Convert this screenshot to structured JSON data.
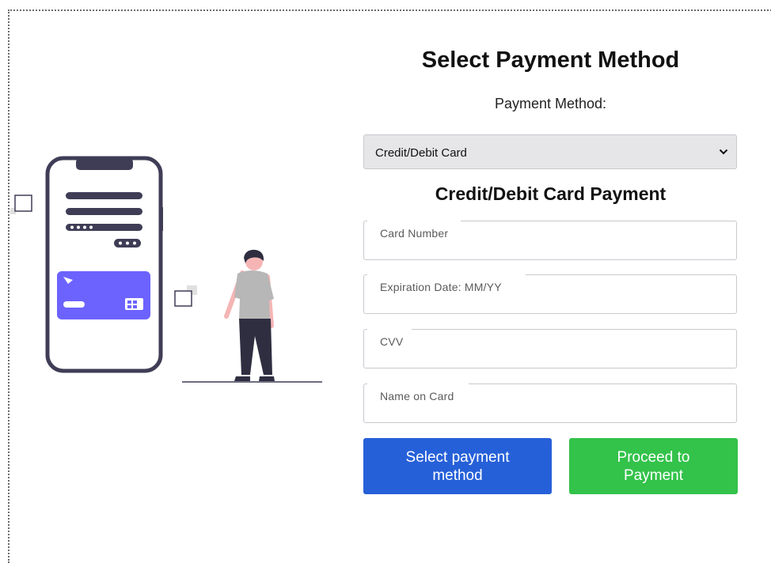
{
  "page": {
    "heading": "Select Payment Method",
    "method_label": "Payment Method:"
  },
  "payment_select": {
    "selected": "Credit/Debit Card",
    "icon": "chevron-down-icon"
  },
  "card_section": {
    "heading": "Credit/Debit Card Payment",
    "fields": [
      {
        "placeholder": "Card Number",
        "value": ""
      },
      {
        "placeholder": "Expiration Date: MM/YY",
        "value": ""
      },
      {
        "placeholder": "CVV",
        "value": ""
      },
      {
        "placeholder": "Name on Card",
        "value": ""
      }
    ]
  },
  "buttons": {
    "select_label": "Select payment method",
    "proceed_label": "Proceed to Payment"
  },
  "colors": {
    "select_button": "#2660d8",
    "proceed_button": "#33c24a",
    "card_illustration": "#6c63ff",
    "phone_outline": "#3f3d56"
  }
}
